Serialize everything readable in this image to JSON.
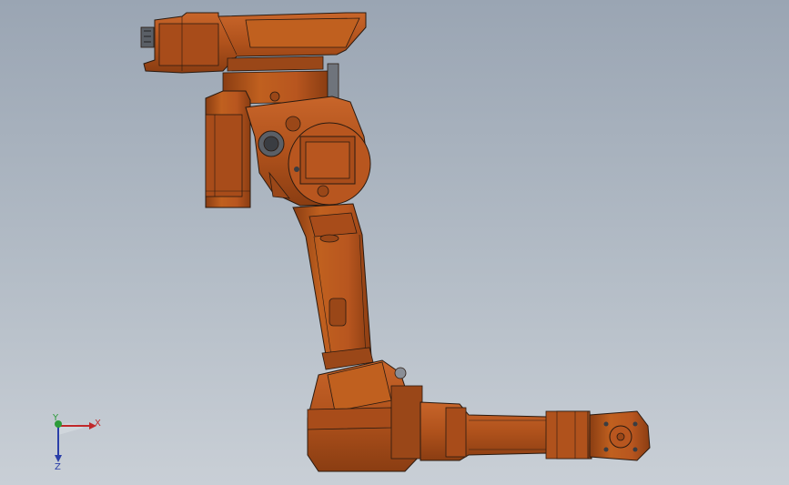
{
  "viewport": {
    "model": "industrial-robot-arm",
    "colors": {
      "background_top": "#9aa5b3",
      "background_bottom": "#c9cfd6",
      "robot_body": "#b8561f",
      "robot_shadow": "#8a3d12",
      "robot_highlight": "#d26a2e",
      "edge_lines": "#2a1a10",
      "gray_part": "#7c8088"
    }
  },
  "triad": {
    "x_label": "X",
    "y_label": "Y",
    "z_label": "Z",
    "colors": {
      "x": "#c0282a",
      "y": "#2d9b3a",
      "z": "#2a3ea8"
    }
  }
}
